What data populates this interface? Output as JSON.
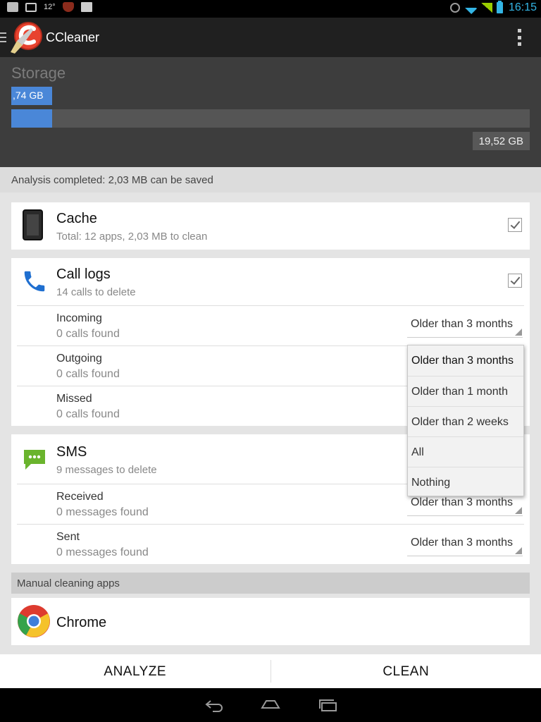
{
  "status_bar": {
    "left_text": "12°",
    "time": "16:15"
  },
  "app": {
    "title": "CCleaner"
  },
  "storage": {
    "title": "Storage",
    "used_label": ",74 GB",
    "total_label": "19,52 GB",
    "used_fraction": 0.079
  },
  "analysis": {
    "message": "Analysis completed: 2,03 MB can be saved"
  },
  "cache": {
    "title": "Cache",
    "subtitle": "Total: 12 apps, 2,03 MB to clean",
    "checked": true
  },
  "call_logs": {
    "title": "Call logs",
    "subtitle": "14 calls to delete",
    "checked": true,
    "items": [
      {
        "title": "Incoming",
        "subtitle": "0 calls found",
        "option": "Older than 3 months"
      },
      {
        "title": "Outgoing",
        "subtitle": "0 calls found"
      },
      {
        "title": "Missed",
        "subtitle": "0 calls found"
      }
    ]
  },
  "sms": {
    "title": "SMS",
    "subtitle": "9 messages to delete",
    "items": [
      {
        "title": "Received",
        "subtitle": "0 messages found",
        "option": "Older than 3 months"
      },
      {
        "title": "Sent",
        "subtitle": "0 messages found",
        "option": "Older than 3 months"
      }
    ]
  },
  "dropdown": {
    "options": [
      "Older than 3 months",
      "Older than 1 month",
      "Older than 2 weeks",
      "All",
      "Nothing"
    ]
  },
  "manual": {
    "header": "Manual cleaning apps",
    "apps": [
      {
        "name": "Chrome"
      }
    ]
  },
  "actions": {
    "analyze": "ANALYZE",
    "clean": "CLEAN"
  },
  "colors": {
    "accent_blue": "#4a87d8",
    "call_blue": "#1f6fd0",
    "sms_green": "#6ab42d",
    "status_blue": "#33b5e5"
  }
}
